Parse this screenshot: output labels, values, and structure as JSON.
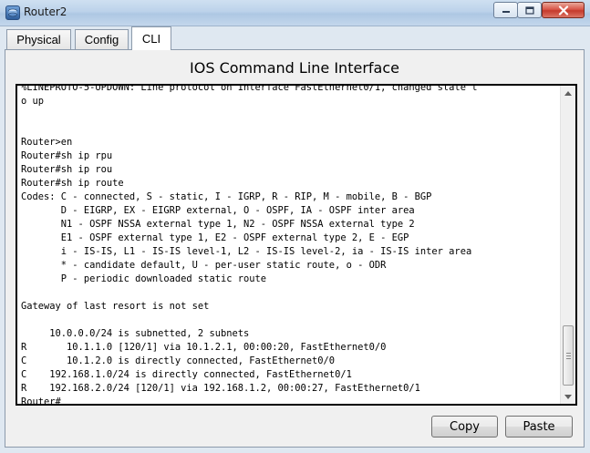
{
  "window": {
    "title": "Router2",
    "icon": "router-app-icon"
  },
  "tabs": [
    {
      "label": "Physical",
      "active": false
    },
    {
      "label": "Config",
      "active": false
    },
    {
      "label": "CLI",
      "active": true
    }
  ],
  "panel": {
    "heading": "IOS Command Line Interface"
  },
  "terminal": {
    "lines": [
      "%LINEPROTO-5-UPDOWN: Line protocol on Interface FastEthernet0/1, changed state t",
      "o up",
      "",
      "",
      "Router>en",
      "Router#sh ip rpu",
      "Router#sh ip rou",
      "Router#sh ip route",
      "Codes: C - connected, S - static, I - IGRP, R - RIP, M - mobile, B - BGP",
      "       D - EIGRP, EX - EIGRP external, O - OSPF, IA - OSPF inter area",
      "       N1 - OSPF NSSA external type 1, N2 - OSPF NSSA external type 2",
      "       E1 - OSPF external type 1, E2 - OSPF external type 2, E - EGP",
      "       i - IS-IS, L1 - IS-IS level-1, L2 - IS-IS level-2, ia - IS-IS inter area",
      "       * - candidate default, U - per-user static route, o - ODR",
      "       P - periodic downloaded static route",
      "",
      "Gateway of last resort is not set",
      "",
      "     10.0.0.0/24 is subnetted, 2 subnets",
      "R       10.1.1.0 [120/1] via 10.1.2.1, 00:00:20, FastEthernet0/0",
      "C       10.1.2.0 is directly connected, FastEthernet0/0",
      "C    192.168.1.0/24 is directly connected, FastEthernet0/1",
      "R    192.168.2.0/24 [120/1] via 192.168.1.2, 00:00:27, FastEthernet0/1",
      "Router#"
    ]
  },
  "buttons": {
    "copy": "Copy",
    "paste": "Paste"
  },
  "colors": {
    "titlebar": "#bcd2ea",
    "close_button": "#c53a2c",
    "panel_background": "#f0f0f0",
    "terminal_background": "#ffffff"
  }
}
